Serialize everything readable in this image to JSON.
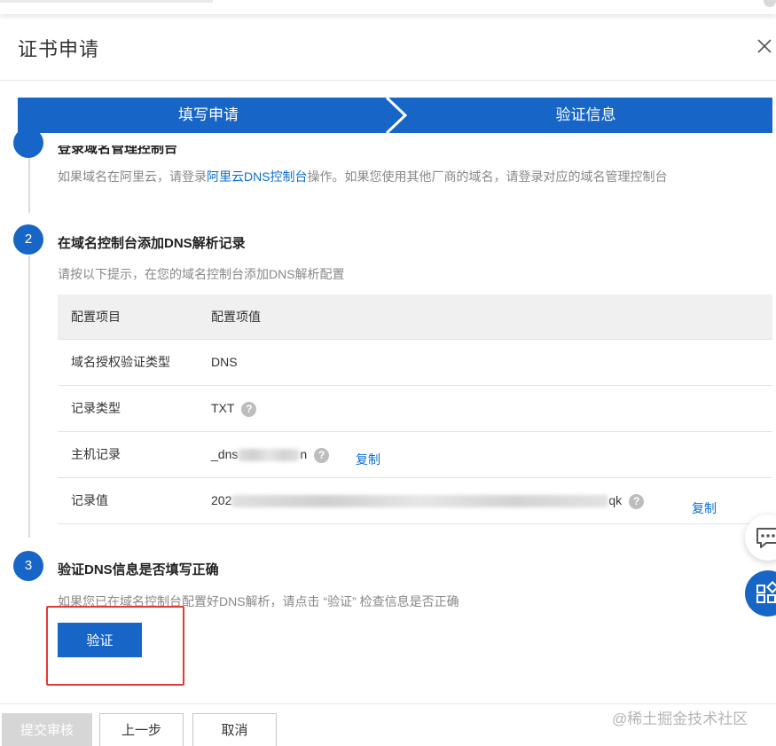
{
  "dialog": {
    "title": "证书申请",
    "close_label": "×"
  },
  "steps": [
    {
      "label": "填写申请",
      "state": "active"
    },
    {
      "label": "验证信息",
      "state": "active"
    }
  ],
  "sections": {
    "s1": {
      "title": "登录域名管理控制台",
      "desc_prefix": "如果域名在阿里云，请登录",
      "desc_link": "阿里云DNS控制台",
      "desc_suffix": "操作。如果您使用其他厂商的域名，请登录对应的域名管理控制台"
    },
    "s2": {
      "number": "2",
      "title": "在域名控制台添加DNS解析记录",
      "desc": "请按以下提示，在您的域名控制台添加DNS解析配置"
    },
    "s3": {
      "number": "3",
      "title": "验证DNS信息是否填写正确",
      "desc": "如果您已在域名控制台配置好DNS解析，请点击 “验证” 检查信息是否正确"
    }
  },
  "config_table": {
    "headers": [
      "配置项目",
      "配置项值"
    ],
    "rows": [
      {
        "key": "域名授权验证类型",
        "value": "DNS"
      },
      {
        "key": "记录类型",
        "value": "TXT",
        "help": "?"
      },
      {
        "key": "主机记录",
        "value_start": "_dns",
        "value_end": "n",
        "help": "?",
        "copy": "复制"
      },
      {
        "key": "记录值",
        "value_start": "202",
        "value_end": "qk",
        "help": "?",
        "copy": "复制"
      }
    ]
  },
  "buttons": {
    "verify": "验证",
    "submit": "提交审核",
    "prev": "上一步",
    "cancel": "取消"
  },
  "watermark": "@稀土掘金技术社区",
  "colors": {
    "primary": "#1766c7",
    "link": "#0a6fd1",
    "highlight": "#e53935"
  },
  "icons": {
    "close": "close-icon",
    "help": "help-circle-icon",
    "chat": "chat-icon",
    "apps": "apps-grid-icon"
  }
}
